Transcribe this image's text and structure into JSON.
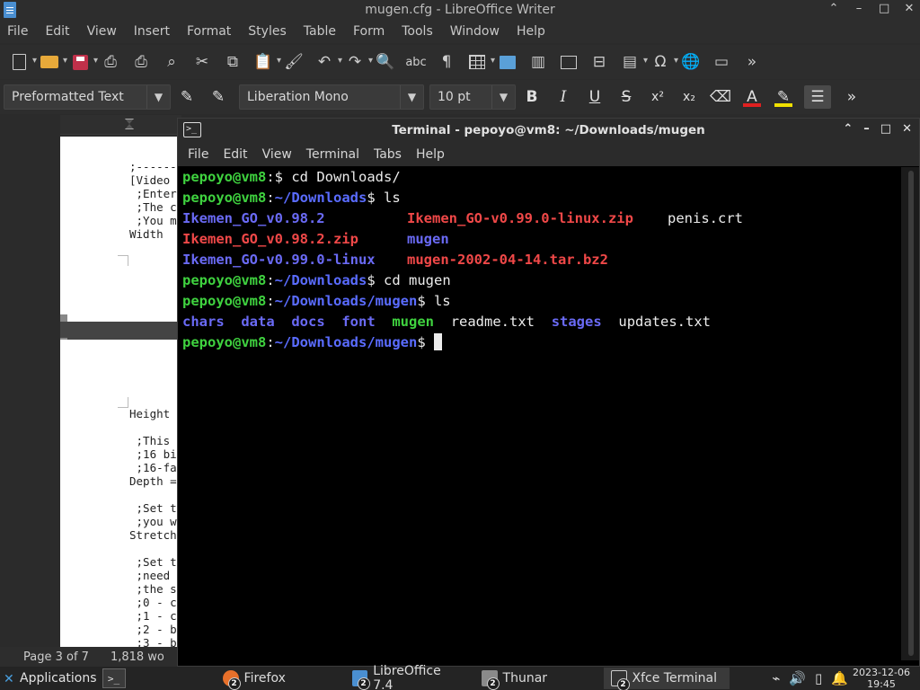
{
  "libreoffice": {
    "title": "mugen.cfg - LibreOffice Writer",
    "menu": [
      "File",
      "Edit",
      "View",
      "Insert",
      "Format",
      "Styles",
      "Table",
      "Form",
      "Tools",
      "Window",
      "Help"
    ],
    "paragraph_style": "Preformatted Text",
    "font_name": "Liberation Mono",
    "font_size": "10 pt",
    "document_page1": [
      ";------",
      "[Video",
      " ;Enter",
      " ;The c",
      " ;You m",
      "Width"
    ],
    "document_page2": [
      "Height",
      "",
      " ;This",
      " ;16 bi",
      " ;16-fa",
      "Depth =",
      "",
      " ;Set t",
      " ;you w",
      "Stretch",
      "",
      " ;Set t",
      " ;need",
      " ;the s",
      " ;0 - c",
      " ;1 - c",
      " ;2 - b",
      " ;3 - b"
    ],
    "status": {
      "page": "Page 3 of 7",
      "words": "1,818 wo"
    },
    "accent_color": "#4a8fd1"
  },
  "terminal": {
    "title": "Terminal - pepoyo@vm8: ~/Downloads/mugen",
    "menu": [
      "File",
      "Edit",
      "View",
      "Terminal",
      "Tabs",
      "Help"
    ],
    "prompt_user": "pepoyo@vm8",
    "lines": {
      "l1_path": "",
      "l1_cmd": "$ cd Downloads/",
      "l2_path": "~/Downloads",
      "l2_cmd": "$ ls",
      "ls1": [
        [
          "Ikemen_GO_v0.98.2",
          "Ikemen_GO-v0.99.0-linux.zip",
          "penis.crt"
        ],
        [
          "Ikemen_GO_v0.98.2.zip",
          "mugen",
          ""
        ],
        [
          "Ikemen_GO-v0.99.0-linux",
          "mugen-2002-04-14.tar.bz2",
          ""
        ]
      ],
      "l6_path": "~/Downloads",
      "l6_cmd": "$ cd mugen",
      "l7_path": "~/Downloads/mugen",
      "l7_cmd": "$ ls",
      "ls2": [
        "chars",
        "data",
        "docs",
        "font",
        "mugen",
        "readme.txt",
        "stages",
        "updates.txt"
      ],
      "l9_path": "~/Downloads/mugen",
      "l9_cmd": "$ "
    },
    "colors": {
      "user": "#3fd23f",
      "directory": "#5b5bff",
      "archive": "#f04848",
      "executable": "#3fd23f"
    }
  },
  "taskbar": {
    "applications_label": "Applications",
    "tasks": [
      {
        "label": "Firefox",
        "badge": "2"
      },
      {
        "label": "LibreOffice 7.4",
        "badge": "2"
      },
      {
        "label": "Thunar",
        "badge": "2"
      },
      {
        "label": "Xfce Terminal",
        "badge": "2"
      }
    ],
    "clock_date": "2023-12-06",
    "clock_time": "19:45"
  }
}
